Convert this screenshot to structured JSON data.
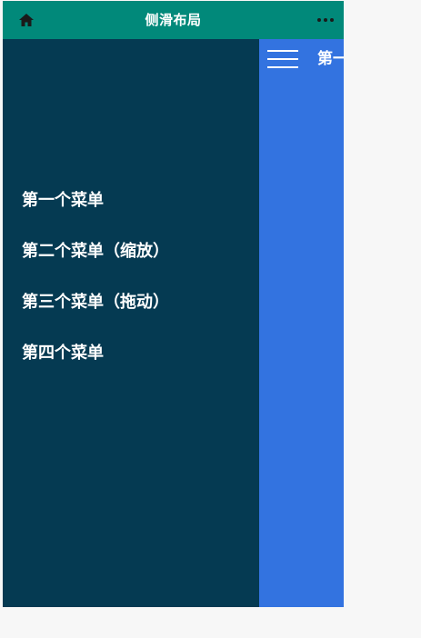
{
  "navbar": {
    "title": "侧滑布局",
    "left_icon": "home-icon",
    "right_icon": "more-icon",
    "color": "#01897a"
  },
  "drawer": {
    "color": "#053a52",
    "items": [
      {
        "label": "第一个菜单"
      },
      {
        "label": "第二个菜单（缩放）"
      },
      {
        "label": "第三个菜单（拖动）"
      },
      {
        "label": "第四个菜单"
      }
    ]
  },
  "content": {
    "color": "#3373e0",
    "menu_icon": "hamburger-menu-icon",
    "title": "第一个菜单"
  }
}
